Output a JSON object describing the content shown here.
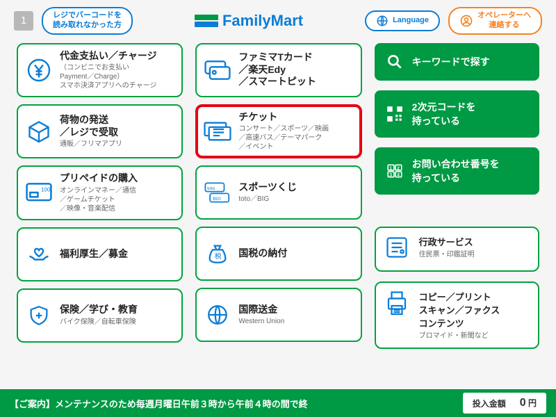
{
  "header": {
    "step_number": "1",
    "barcode_help": "レジでバーコードを\n読み取れなかった方",
    "brand": "FamilyMart",
    "language_label": "Language",
    "operator_label": "オペレーターへ\n連絡する"
  },
  "cards_left": [
    {
      "title": "代金支払い／チャージ",
      "sub": "（コンビニでお支払い\nPayment／Charge）\nスマホ決済アプリへのチャージ"
    },
    {
      "title": "荷物の発送\n／レジで受取",
      "sub": "通販／フリマアプリ"
    },
    {
      "title": "プリペイドの購入",
      "sub": "オンラインマネー／通信\n／ゲームチケット\n／映像・音楽配信"
    },
    {
      "title": "福利厚生／募金",
      "sub": ""
    },
    {
      "title": "保険／学び・教育",
      "sub": "バイク保険／自転車保険"
    }
  ],
  "cards_mid": [
    {
      "title": "ファミマTカード\n／楽天Edy\n／スマートピット",
      "sub": ""
    },
    {
      "title": "チケット",
      "sub": "コンサート／スポーツ／映画\n／高速バス／テーマパーク\n／イベント",
      "highlight": true
    },
    {
      "title": "スポーツくじ",
      "sub": "toto／BIG"
    },
    {
      "title": "国税の納付",
      "sub": ""
    },
    {
      "title": "国際送金",
      "sub": "Western Union"
    }
  ],
  "right_buttons": [
    {
      "label": "キーワードで探す"
    },
    {
      "label": "2次元コードを\n持っている"
    },
    {
      "label": "お問い合わせ番号を\n持っている"
    }
  ],
  "right_cards": [
    {
      "title": "行政サービス",
      "sub": "住民票・印鑑証明"
    },
    {
      "title": "コピー／プリント\nスキャン／ファクス\nコンテンツ",
      "sub": "ブロマイド・新聞など"
    }
  ],
  "footer": {
    "message": "【ご案内】メンテナンスのため毎週月曜日午前３時から午前４時の間で終",
    "amount_label": "投入金額",
    "amount_value": "0",
    "amount_unit": "円"
  }
}
